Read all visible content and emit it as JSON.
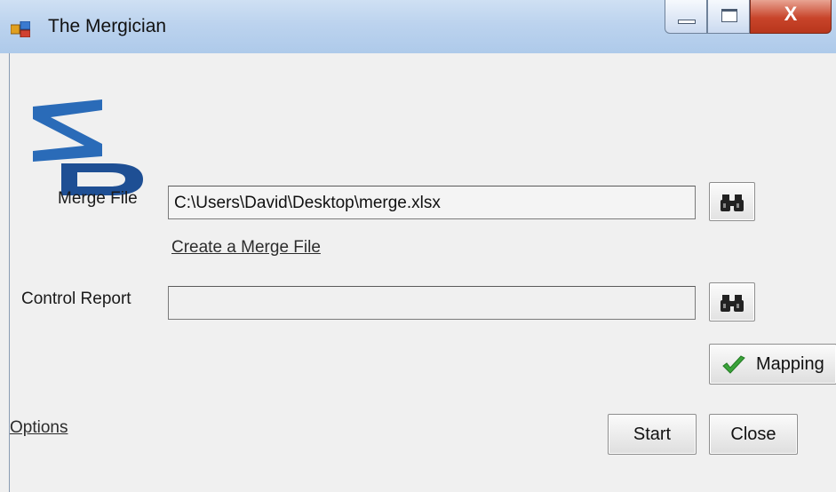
{
  "window": {
    "title": "The Mergician",
    "icon": "app-window-icon",
    "controls": [
      "minimize-icon",
      "maximize-icon",
      "close-icon"
    ],
    "close_glyph": "X"
  },
  "logo": {
    "text": "ZD",
    "colors": [
      "#2a6bb8",
      "#1e4f94"
    ]
  },
  "merge_file": {
    "label": "Merge File",
    "value": "C:\\Users\\David\\Desktop\\merge.xlsx",
    "browse_icon": "binoculars-icon"
  },
  "create_link": "Create a Merge File",
  "control_report": {
    "label": "Control Report",
    "value": "",
    "browse_icon": "binoculars-icon"
  },
  "mapping_button": {
    "label": "Mapping",
    "icon": "checkmark-icon",
    "icon_color": "#3aa33a"
  },
  "options_link": "Options",
  "start_button": "Start",
  "close_button": "Close"
}
